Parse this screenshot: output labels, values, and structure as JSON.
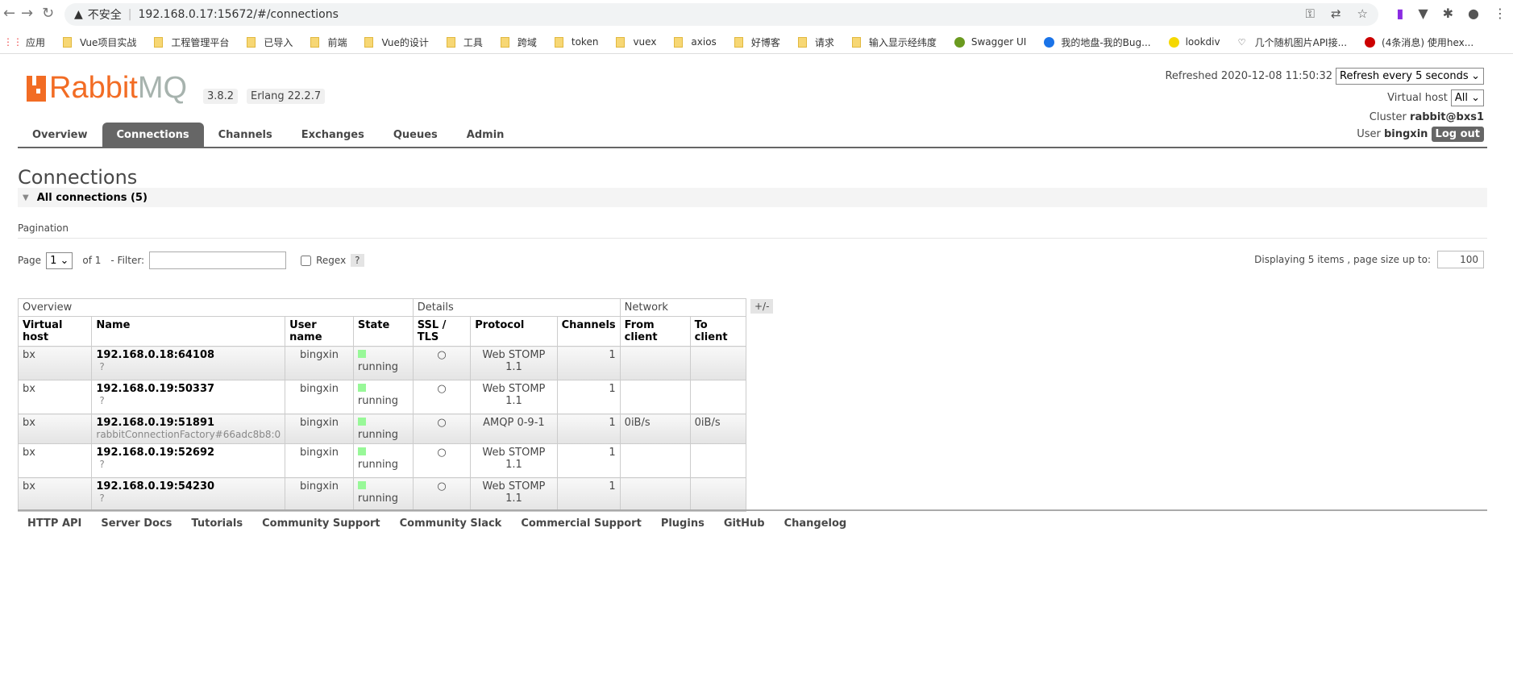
{
  "browser": {
    "security": "不安全",
    "url": "192.168.0.17:15672/#/connections",
    "bookmarks": [
      "应用",
      "Vue项目实战",
      "工程管理平台",
      "已导入",
      "前端",
      "Vue的设计",
      "工具",
      "跨域",
      "token",
      "vuex",
      "axios",
      "好博客",
      "请求",
      "输入显示经纬度",
      "Swagger UI",
      "我的地盘-我的Bug...",
      "lookdiv",
      "几个随机图片API接...",
      "(4条消息) 使用hex..."
    ]
  },
  "header": {
    "logo_text": "RabbitMQ",
    "version": "3.8.2",
    "erlang": "Erlang 22.2.7",
    "refreshed_label": "Refreshed 2020-12-08 11:50:32",
    "refresh_option": "Refresh every 5 seconds",
    "vhost_label": "Virtual host",
    "vhost_value": "All",
    "cluster_label": "Cluster",
    "cluster_value": "rabbit@bxs1",
    "user_label": "User",
    "user_value": "bingxin",
    "logout": "Log out"
  },
  "tabs": [
    "Overview",
    "Connections",
    "Channels",
    "Exchanges",
    "Queues",
    "Admin"
  ],
  "page": {
    "title": "Connections",
    "section": "All connections (5)",
    "pagination": "Pagination",
    "page_label": "Page",
    "page_value": "1",
    "of_label": "of 1",
    "filter_label": "- Filter:",
    "filter_value": "",
    "regex_label": "Regex",
    "help": "?",
    "displaying": "Displaying 5 items , page size up to:",
    "page_size": "100"
  },
  "table": {
    "groups": [
      "Overview",
      "Details",
      "Network"
    ],
    "plusminus": "+/-",
    "columns": [
      "Virtual host",
      "Name",
      "User name",
      "State",
      "SSL / TLS",
      "Protocol",
      "Channels",
      "From client",
      "To client"
    ],
    "rows": [
      {
        "vhost": "bx",
        "name": "192.168.0.18:64108",
        "sub": "?",
        "user": "bingxin",
        "state": "running",
        "ssl": "○",
        "protocol": "Web STOMP 1.1",
        "channels": "1",
        "from": "",
        "to": ""
      },
      {
        "vhost": "bx",
        "name": "192.168.0.19:50337",
        "sub": "?",
        "user": "bingxin",
        "state": "running",
        "ssl": "○",
        "protocol": "Web STOMP 1.1",
        "channels": "1",
        "from": "",
        "to": ""
      },
      {
        "vhost": "bx",
        "name": "192.168.0.19:51891",
        "sub": "rabbitConnectionFactory#66adc8b8:0",
        "user": "bingxin",
        "state": "running",
        "ssl": "○",
        "protocol": "AMQP 0-9-1",
        "channels": "1",
        "from": "0iB/s",
        "to": "0iB/s"
      },
      {
        "vhost": "bx",
        "name": "192.168.0.19:52692",
        "sub": "?",
        "user": "bingxin",
        "state": "running",
        "ssl": "○",
        "protocol": "Web STOMP 1.1",
        "channels": "1",
        "from": "",
        "to": ""
      },
      {
        "vhost": "bx",
        "name": "192.168.0.19:54230",
        "sub": "?",
        "user": "bingxin",
        "state": "running",
        "ssl": "○",
        "protocol": "Web STOMP 1.1",
        "channels": "1",
        "from": "",
        "to": ""
      }
    ]
  },
  "footer": [
    "HTTP API",
    "Server Docs",
    "Tutorials",
    "Community Support",
    "Community Slack",
    "Commercial Support",
    "Plugins",
    "GitHub",
    "Changelog"
  ],
  "colors": {
    "brand": "#f26c24",
    "tab_active": "#666666",
    "running": "#98f898"
  }
}
